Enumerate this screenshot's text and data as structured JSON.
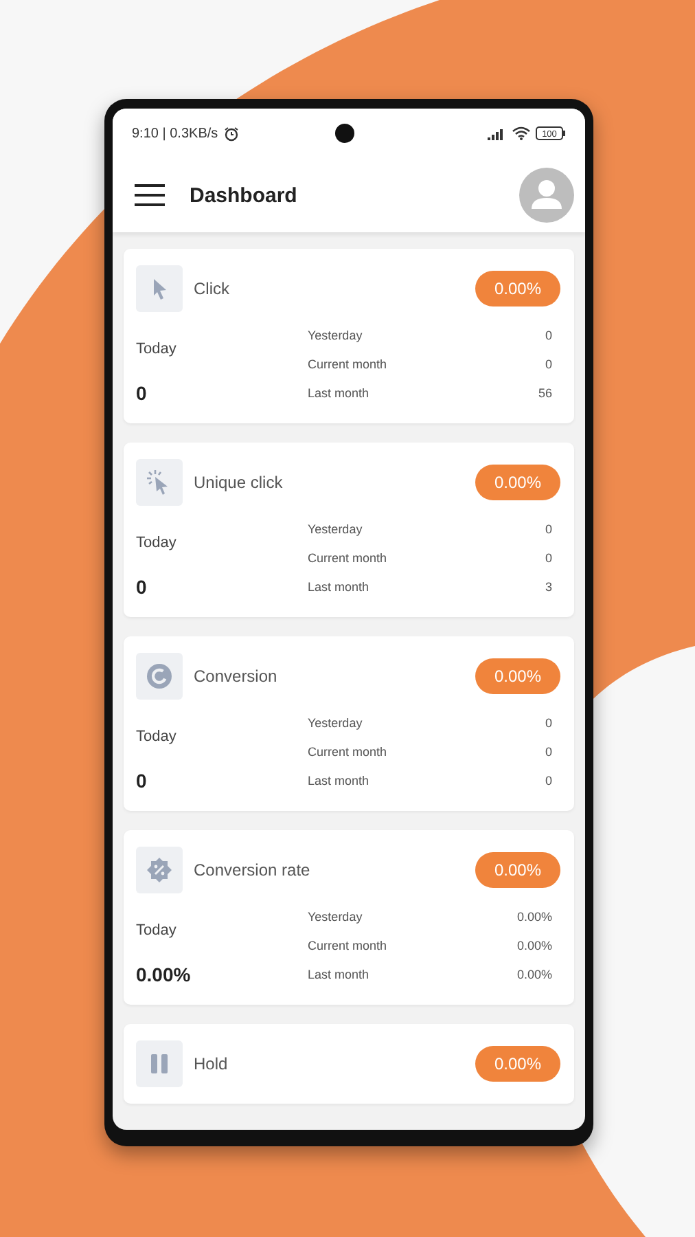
{
  "status_bar": {
    "time": "9:10 | 0.3KB/s",
    "battery": "100"
  },
  "app_bar": {
    "title": "Dashboard"
  },
  "cards": [
    {
      "kind": "click",
      "title": "Click",
      "badge": "0.00%",
      "today_label": "Today",
      "today_value": "0",
      "stats": [
        {
          "label": "Yesterday",
          "value": "0"
        },
        {
          "label": "Current month",
          "value": "0"
        },
        {
          "label": "Last month",
          "value": "56"
        }
      ]
    },
    {
      "kind": "unique_click",
      "title": "Unique click",
      "badge": "0.00%",
      "today_label": "Today",
      "today_value": "0",
      "stats": [
        {
          "label": "Yesterday",
          "value": "0"
        },
        {
          "label": "Current month",
          "value": "0"
        },
        {
          "label": "Last month",
          "value": "3"
        }
      ]
    },
    {
      "kind": "conversion",
      "title": "Conversion",
      "badge": "0.00%",
      "today_label": "Today",
      "today_value": "0",
      "stats": [
        {
          "label": "Yesterday",
          "value": "0"
        },
        {
          "label": "Current month",
          "value": "0"
        },
        {
          "label": "Last month",
          "value": "0"
        }
      ]
    },
    {
      "kind": "rate",
      "title": "Conversion rate",
      "badge": "0.00%",
      "today_label": "Today",
      "today_value": "0.00%",
      "stats": [
        {
          "label": "Yesterday",
          "value": "0.00%"
        },
        {
          "label": "Current month",
          "value": "0.00%"
        },
        {
          "label": "Last month",
          "value": "0.00%"
        }
      ]
    },
    {
      "kind": "hold",
      "title": "Hold",
      "badge": "0.00%"
    }
  ]
}
